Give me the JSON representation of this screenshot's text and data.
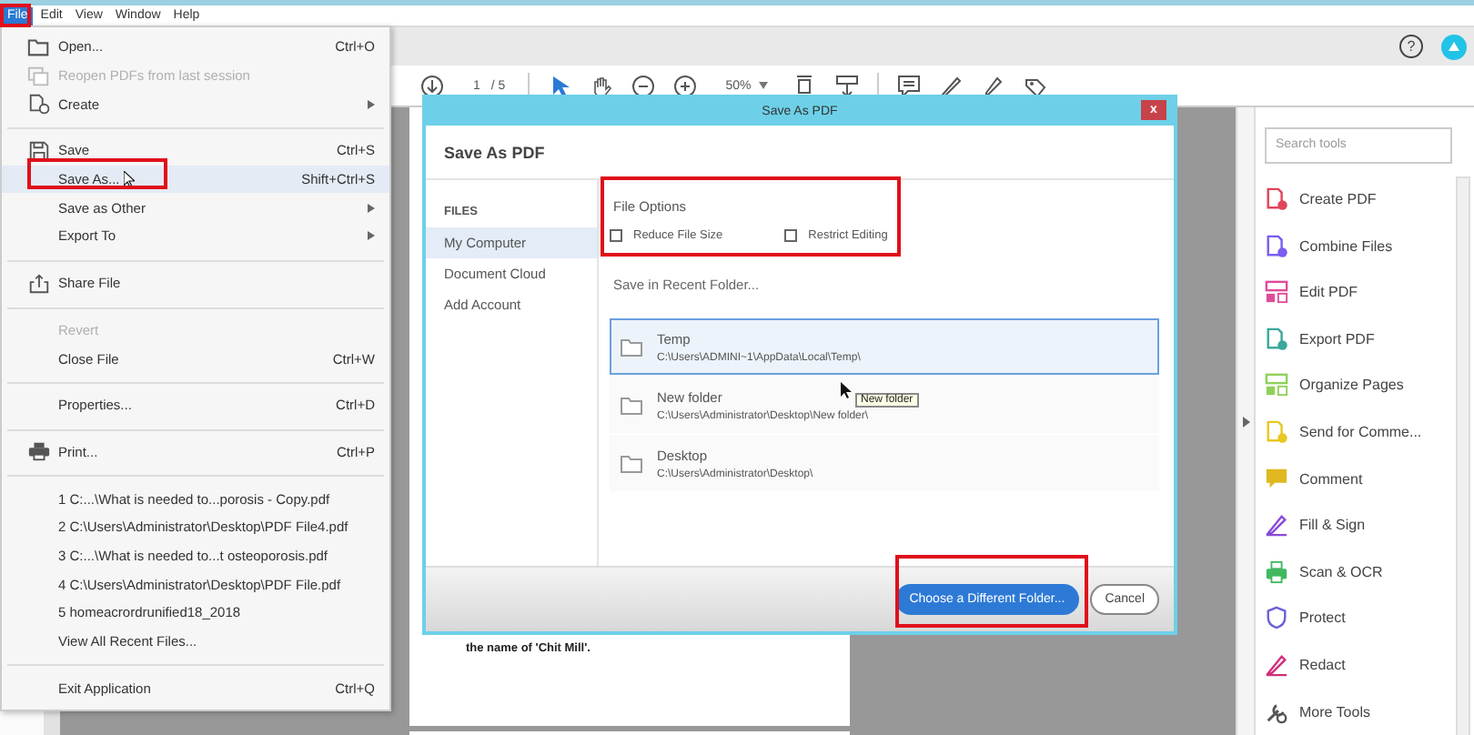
{
  "menu_bar": [
    {
      "label": "File",
      "selected": true
    },
    {
      "label": "Edit",
      "selected": false
    },
    {
      "label": "View",
      "selected": false
    },
    {
      "label": "Window",
      "selected": false
    },
    {
      "label": "Help",
      "selected": false
    }
  ],
  "header": {
    "help": "?"
  },
  "toolbar": {
    "page_number": "1",
    "page_count": "/ 5",
    "zoom": "50%"
  },
  "file_menu": {
    "items": [
      {
        "kind": "open",
        "label": "Open...",
        "shortcut": "Ctrl+O",
        "submenu": false,
        "disabled": false,
        "selected": false
      },
      {
        "kind": "reopen",
        "label": "Reopen PDFs from last session",
        "submenu": false,
        "disabled": true,
        "selected": false
      },
      {
        "kind": "create",
        "label": "Create",
        "submenu": true,
        "disabled": false,
        "selected": false
      },
      {
        "kind": "separator"
      },
      {
        "kind": "save",
        "label": "Save",
        "shortcut": "Ctrl+S",
        "submenu": false,
        "disabled": false,
        "selected": false
      },
      {
        "kind": "command",
        "label": "Save As...",
        "shortcut": "Shift+Ctrl+S",
        "submenu": false,
        "disabled": false,
        "selected": true
      },
      {
        "kind": "command",
        "label": "Save as Other",
        "submenu": true,
        "disabled": false,
        "selected": false
      },
      {
        "kind": "command",
        "label": "Export To",
        "submenu": true,
        "disabled": false,
        "selected": false
      },
      {
        "kind": "separator"
      },
      {
        "kind": "share",
        "label": "Share File",
        "submenu": false,
        "disabled": false,
        "selected": false
      },
      {
        "kind": "separator"
      },
      {
        "kind": "command",
        "label": "Revert",
        "submenu": false,
        "disabled": true,
        "selected": false
      },
      {
        "kind": "command",
        "label": "Close File",
        "shortcut": "Ctrl+W",
        "submenu": false,
        "disabled": false,
        "selected": false
      },
      {
        "kind": "separator"
      },
      {
        "kind": "command",
        "label": "Properties...",
        "shortcut": "Ctrl+D",
        "submenu": false,
        "disabled": false,
        "selected": false
      },
      {
        "kind": "separator"
      },
      {
        "kind": "print",
        "label": "Print...",
        "shortcut": "Ctrl+P",
        "submenu": false,
        "disabled": false,
        "selected": false
      },
      {
        "kind": "separator"
      },
      {
        "kind": "command",
        "label": "1 C:...\\What is needed to...porosis - Copy.pdf",
        "submenu": false,
        "disabled": false,
        "selected": false
      },
      {
        "kind": "command",
        "label": "2 C:\\Users\\Administrator\\Desktop\\PDF File4.pdf",
        "submenu": false,
        "disabled": false,
        "selected": false
      },
      {
        "kind": "command",
        "label": "3 C:...\\What is needed to...t osteoporosis.pdf",
        "submenu": false,
        "disabled": false,
        "selected": false
      },
      {
        "kind": "command",
        "label": "4 C:\\Users\\Administrator\\Desktop\\PDF File.pdf",
        "submenu": false,
        "disabled": false,
        "selected": false
      },
      {
        "kind": "command",
        "label": "5 homeacrordrunified18_2018",
        "submenu": false,
        "disabled": false,
        "selected": false
      },
      {
        "kind": "command",
        "label": "View All Recent Files...",
        "submenu": false,
        "disabled": false,
        "selected": false
      },
      {
        "kind": "separator"
      },
      {
        "kind": "command",
        "label": "Exit Application",
        "shortcut": "Ctrl+Q",
        "submenu": false,
        "disabled": false,
        "selected": false
      }
    ]
  },
  "document": {
    "text": "the name of 'Chit Mill'."
  },
  "dialog": {
    "title": "Save As PDF",
    "close": "x",
    "heading": "Save As PDF",
    "sidebar": {
      "heading": "FILES",
      "items": [
        {
          "label": "My Computer",
          "selected": true
        },
        {
          "label": "Document Cloud",
          "selected": false
        },
        {
          "label": "Add Account",
          "selected": false
        }
      ]
    },
    "file_options": {
      "heading": "File Options",
      "options": [
        {
          "label": "Reduce File Size",
          "checked": false
        },
        {
          "label": "Restrict Editing",
          "checked": false
        }
      ]
    },
    "recent_heading": "Save in Recent Folder...",
    "folders": [
      {
        "name": "Temp",
        "path": "C:\\Users\\ADMINI~1\\AppData\\Local\\Temp\\",
        "selected": true
      },
      {
        "name": "New folder",
        "path": "C:\\Users\\Administrator\\Desktop\\New folder\\",
        "selected": false
      },
      {
        "name": "Desktop",
        "path": "C:\\Users\\Administrator\\Desktop\\",
        "selected": false
      }
    ],
    "tooltip": "New folder",
    "buttons": [
      {
        "label": "Choose a Different Folder...",
        "kind": "primary"
      },
      {
        "label": "Cancel",
        "kind": "secondary"
      }
    ]
  },
  "tools_panel": {
    "search": {
      "placeholder": "Search tools"
    },
    "tools": [
      {
        "label": "Create PDF",
        "color": "#e0455a",
        "kind": "document"
      },
      {
        "label": "Combine Files",
        "color": "#7a5cf0",
        "kind": "document"
      },
      {
        "label": "Edit PDF",
        "color": "#e04c9a",
        "kind": "layout"
      },
      {
        "label": "Export PDF",
        "color": "#3aa89a",
        "kind": "document"
      },
      {
        "label": "Organize Pages",
        "color": "#8fd15a",
        "kind": "layout"
      },
      {
        "label": "Send for Comme...",
        "color": "#e8c820",
        "kind": "document"
      },
      {
        "label": "Comment",
        "color": "#e0b820",
        "kind": "bubble"
      },
      {
        "label": "Fill & Sign",
        "color": "#8a4ad8",
        "kind": "pen"
      },
      {
        "label": "Scan & OCR",
        "color": "#40b860",
        "kind": "printer"
      },
      {
        "label": "Protect",
        "color": "#6a60d8",
        "kind": "shield"
      },
      {
        "label": "Redact",
        "color": "#d0307a",
        "kind": "pen"
      },
      {
        "label": "More Tools",
        "color": "#555555",
        "kind": "wrench"
      }
    ]
  }
}
